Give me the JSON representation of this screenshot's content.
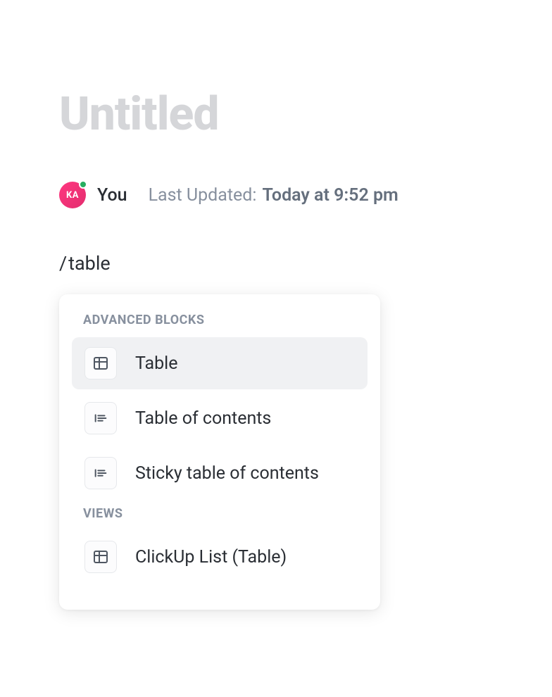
{
  "page": {
    "title": "Untitled"
  },
  "author": {
    "initials": "KA",
    "status": "online",
    "name": "You"
  },
  "meta": {
    "updated_label": "Last Updated:",
    "updated_time": "Today at 9:52 pm"
  },
  "input": {
    "slash": "/",
    "query": "table"
  },
  "dropdown": {
    "sections": [
      {
        "header": "ADVANCED BLOCKS",
        "items": [
          {
            "label": "Table",
            "icon": "table",
            "selected": true
          },
          {
            "label": "Table of contents",
            "icon": "toc",
            "selected": false
          },
          {
            "label": "Sticky table of contents",
            "icon": "toc",
            "selected": false
          }
        ]
      },
      {
        "header": "VIEWS",
        "items": [
          {
            "label": "ClickUp List (Table)",
            "icon": "table",
            "selected": false
          }
        ]
      }
    ]
  }
}
